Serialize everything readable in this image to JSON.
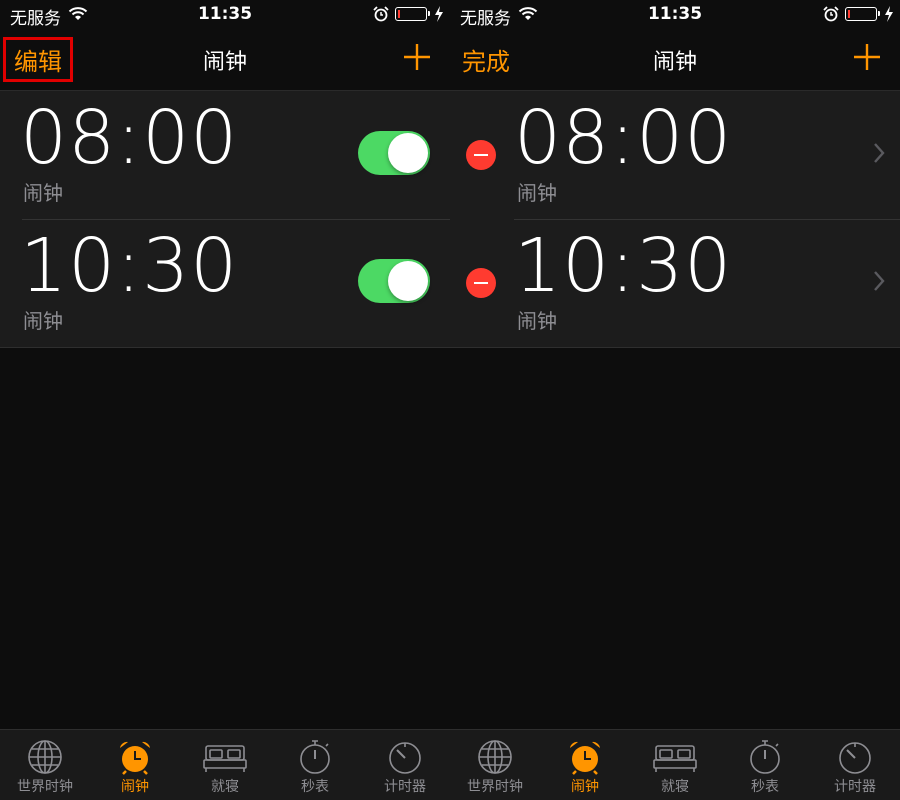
{
  "colors": {
    "accent": "#ff9500",
    "toggle_on": "#4cd964",
    "delete": "#ff3b30",
    "highlight_box": "#e10000"
  },
  "left": {
    "status": {
      "carrier": "无服务",
      "time": "11:35"
    },
    "nav": {
      "left_label": "编辑",
      "title": "闹钟",
      "add_icon": "plus-icon"
    },
    "alarms": [
      {
        "time": "08:00",
        "label": "闹钟",
        "enabled": true
      },
      {
        "time": "10:30",
        "label": "闹钟",
        "enabled": true
      }
    ]
  },
  "right": {
    "status": {
      "carrier": "无服务",
      "time": "11:35"
    },
    "nav": {
      "left_label": "完成",
      "title": "闹钟",
      "add_icon": "plus-icon"
    },
    "alarms": [
      {
        "time": "08:00",
        "label": "闹钟"
      },
      {
        "time": "10:30",
        "label": "闹钟"
      }
    ]
  },
  "tabs": [
    {
      "label": "世界时钟",
      "icon": "globe-icon"
    },
    {
      "label": "闹钟",
      "icon": "alarm-clock-icon",
      "active": true
    },
    {
      "label": "就寝",
      "icon": "bed-icon"
    },
    {
      "label": "秒表",
      "icon": "stopwatch-icon"
    },
    {
      "label": "计时器",
      "icon": "timer-icon"
    }
  ]
}
